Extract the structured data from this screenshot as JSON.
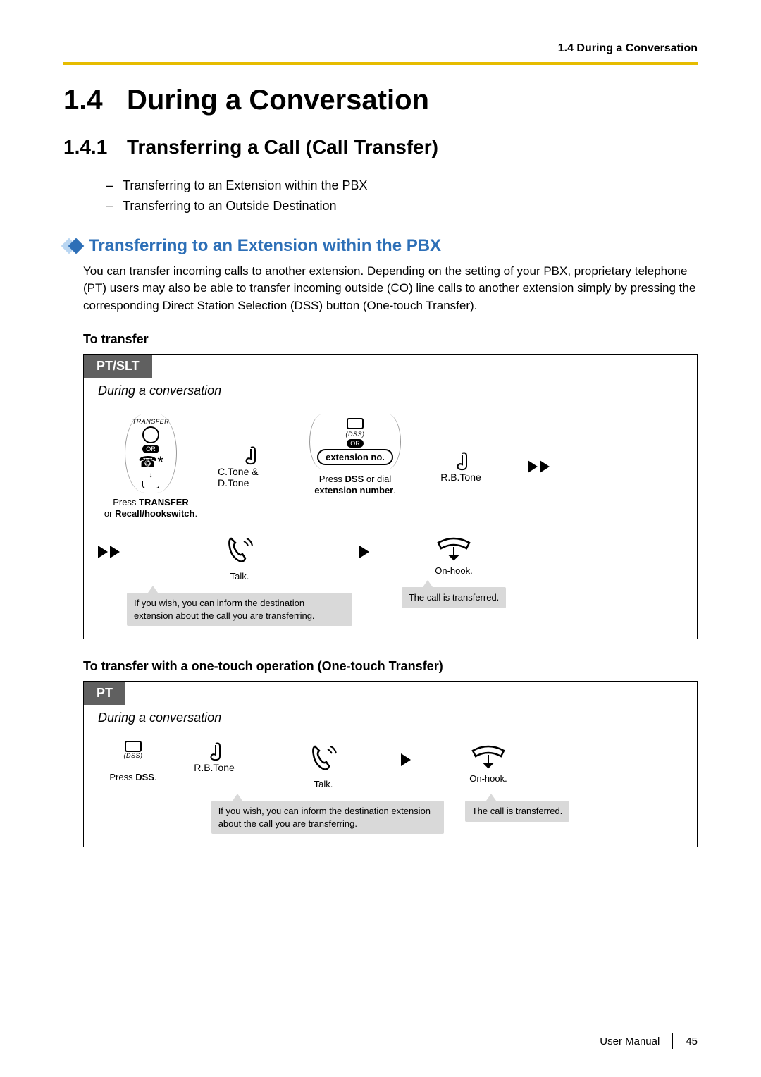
{
  "running_head": "1.4 During a Conversation",
  "h1": {
    "num": "1.4",
    "title": "During a Conversation"
  },
  "h2": {
    "num": "1.4.1",
    "title": "Transferring a Call (Call Transfer)"
  },
  "bullets": [
    "Transferring to an Extension within the PBX",
    "Transferring to an Outside Destination"
  ],
  "h3": "Transferring to an Extension within the PBX",
  "intro": "You can transfer incoming calls to another extension. Depending on the setting of your PBX, proprietary telephone (PT) users may also be able to transfer incoming outside (CO) line calls to another extension simply by pressing the corresponding Direct Station Selection (DSS) button (One-touch Transfer).",
  "proc1": {
    "heading": "To transfer",
    "tab": "PT/SLT",
    "context": "During a conversation",
    "transfer_label": "TRANSFER",
    "or": "OR",
    "step1_caption_a": "Press ",
    "step1_caption_b": "TRANSFER",
    "step1_caption_c": "or ",
    "step1_caption_d": "Recall/hookswitch",
    "tone1": "C.Tone & D.Tone",
    "dss_label": "(DSS)",
    "ext_pill": "extension no.",
    "step2_caption_a": "Press ",
    "step2_caption_b": "DSS",
    "step2_caption_c": " or dial",
    "step2_caption_d": "extension number",
    "tone2": "R.B.Tone",
    "talk": "Talk.",
    "talk_tip": "If you wish, you can inform the destination extension about the call you are transferring.",
    "onhook": "On-hook.",
    "onhook_tip": "The call is transferred."
  },
  "proc2": {
    "heading": "To transfer with a one-touch operation (One-touch Transfer)",
    "tab": "PT",
    "context": "During a conversation",
    "dss_label": "(DSS)",
    "step1_caption_a": "Press ",
    "step1_caption_b": "DSS",
    "tone": "R.B.Tone",
    "talk": "Talk.",
    "talk_tip": "If you wish, you can inform the destination extension about the call you are transferring.",
    "onhook": "On-hook.",
    "onhook_tip": "The call is transferred."
  },
  "footer": {
    "label": "User Manual",
    "page": "45"
  }
}
